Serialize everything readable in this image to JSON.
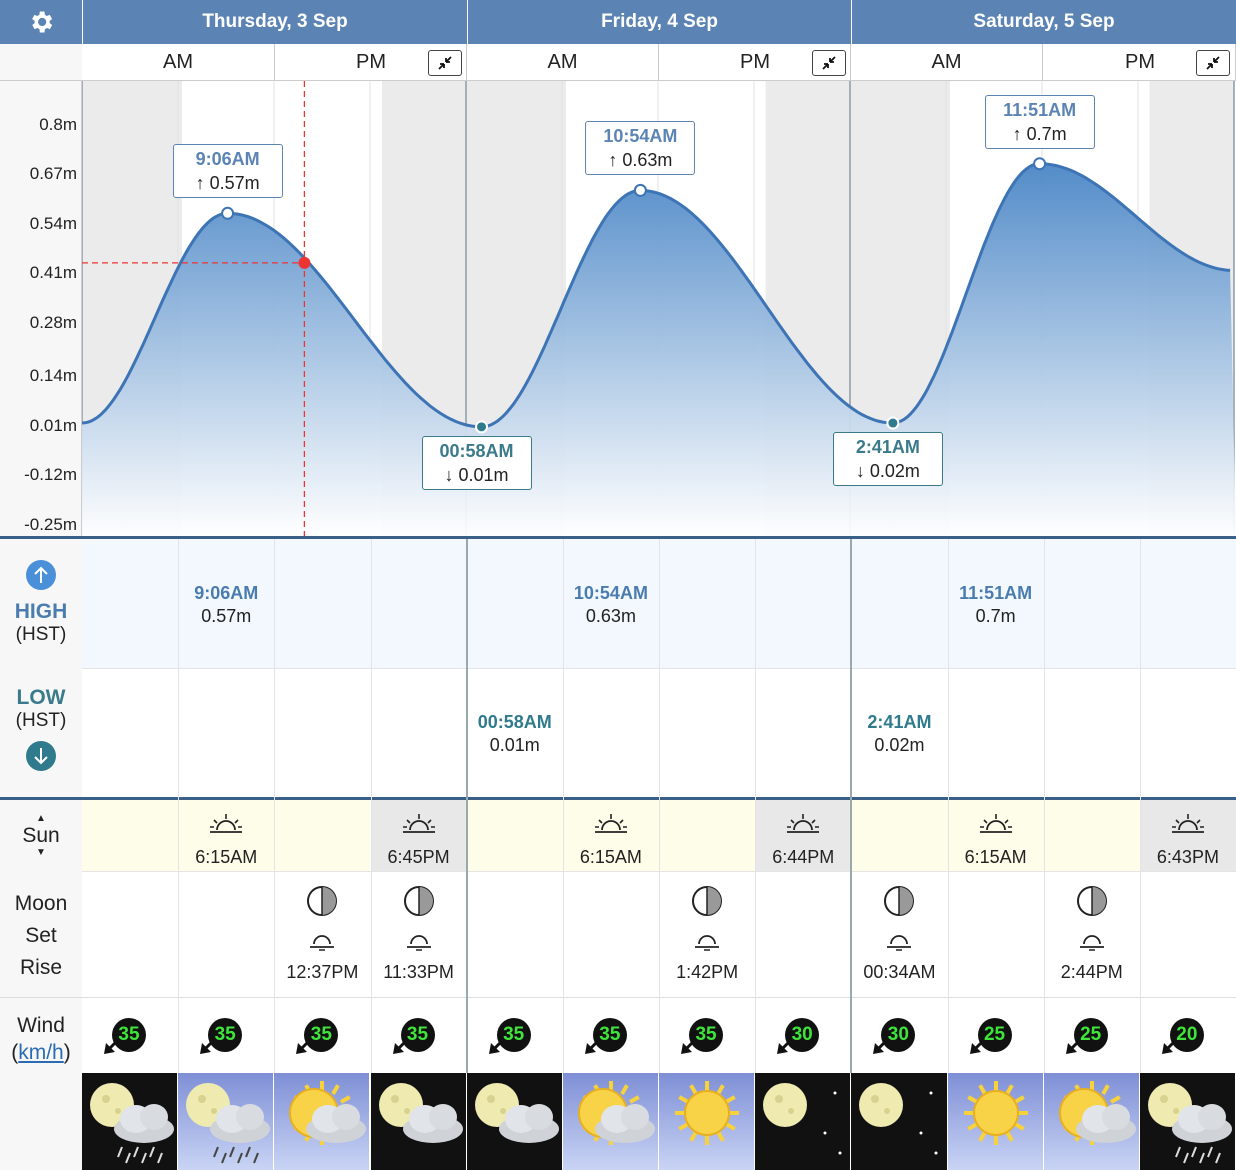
{
  "days": [
    {
      "label": "Thursday, 3 Sep"
    },
    {
      "label": "Friday, 4 Sep"
    },
    {
      "label": "Saturday, 5 Sep"
    }
  ],
  "ampm": {
    "am": "AM",
    "pm": "PM"
  },
  "chart_data": {
    "type": "area",
    "y_ticks": [
      "0.8m",
      "0.67m",
      "0.54m",
      "0.41m",
      "0.28m",
      "0.14m",
      "0.01m",
      "-0.12m",
      "-0.25m"
    ],
    "ylim": [
      -0.25,
      0.93
    ],
    "x_unit": "hours since start of Thursday, 3 Sep",
    "series": [
      {
        "x": [
          0,
          9.1,
          24.97,
          34.9,
          50.68,
          59.85,
          72
        ],
        "y": [
          0.02,
          0.57,
          0.01,
          0.63,
          0.02,
          0.7,
          0.42
        ]
      }
    ],
    "highs": [
      {
        "time": "9:06AM",
        "value": "0.57m"
      },
      {
        "time": "10:54AM",
        "value": "0.63m"
      },
      {
        "time": "11:51AM",
        "value": "0.7m"
      }
    ],
    "lows": [
      {
        "time": "00:58AM",
        "value": "0.01m"
      },
      {
        "time": "2:41AM",
        "value": "0.02m"
      }
    ]
  },
  "left": {
    "high_label": "HIGH",
    "high_tz": "(HST)",
    "low_label": "LOW",
    "low_tz": "(HST)",
    "sun_label": "Sun",
    "moon_label": "Moon",
    "set_label": "Set",
    "rise_label": "Rise",
    "wind_label": "Wind",
    "wind_open": "(",
    "wind_unit": "km/h",
    "wind_close": ")"
  },
  "tides": {
    "high": [
      {
        "time": "9:06AM",
        "value": "0.57m"
      },
      {
        "time": "10:54AM",
        "value": "0.63m"
      },
      {
        "time": "11:51AM",
        "value": "0.7m"
      }
    ],
    "low": [
      {
        "time": "00:58AM",
        "value": "0.01m"
      },
      {
        "time": "2:41AM",
        "value": "0.02m"
      }
    ]
  },
  "sun": [
    {
      "col": 1,
      "time": "6:15AM"
    },
    {
      "col": 3,
      "time": "6:45PM"
    },
    {
      "col": 5,
      "time": "6:15AM"
    },
    {
      "col": 7,
      "time": "6:44PM"
    },
    {
      "col": 9,
      "time": "6:15AM"
    },
    {
      "col": 11,
      "time": "6:43PM"
    }
  ],
  "moon": [
    {
      "col": 2,
      "time": "12:37PM"
    },
    {
      "col": 3,
      "time": "11:33PM"
    },
    {
      "col": 6,
      "time": "1:42PM"
    },
    {
      "col": 8,
      "time": "00:34AM"
    },
    {
      "col": 10,
      "time": "2:44PM"
    }
  ],
  "wind": [
    "35",
    "35",
    "35",
    "35",
    "35",
    "35",
    "35",
    "30",
    "30",
    "25",
    "25",
    "20"
  ],
  "weather": [
    "night-cloud-rain",
    "day-cloud-rain",
    "day-sun-cloud",
    "night-cloud",
    "night-cloud",
    "day-sun-cloud",
    "day-sun",
    "night-clear",
    "night-clear",
    "day-sun",
    "day-sun-cloud",
    "night-cloud-rain"
  ]
}
